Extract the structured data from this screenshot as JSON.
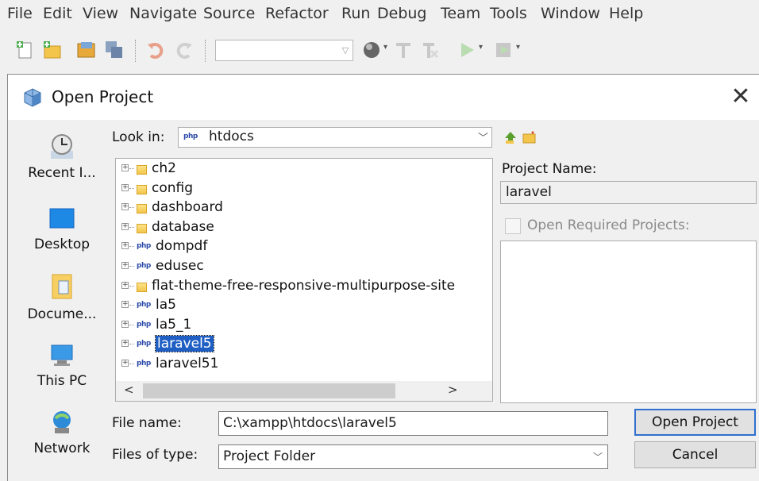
{
  "menubar": {
    "items": [
      "File",
      "Edit",
      "View",
      "Navigate",
      "Source",
      "Refactor",
      "Run",
      "Debug",
      "Team",
      "Tools",
      "Window",
      "Help"
    ]
  },
  "toolbar": {
    "buttons": [
      "new-file-icon",
      "new-project-icon",
      "open-project-icon",
      "save-all-icon",
      "undo-icon",
      "redo-icon",
      "configuration-combo",
      "globe-icon",
      "build-icon",
      "clean-build-icon",
      "run-icon",
      "debug-icon"
    ],
    "configuration_value": ""
  },
  "dialog": {
    "title": "Open Project",
    "close_glyph": "✕",
    "look_in_label": "Look in:",
    "look_in_php_tag": "php",
    "look_in_value": "htdocs",
    "places": [
      {
        "label": "Recent I...",
        "icon": "recent-items-icon"
      },
      {
        "label": "Desktop",
        "icon": "desktop-icon"
      },
      {
        "label": "Docume...",
        "icon": "documents-icon"
      },
      {
        "label": "This PC",
        "icon": "this-pc-icon"
      },
      {
        "label": "Network",
        "icon": "network-icon"
      }
    ],
    "tree_items": [
      {
        "name": "ch2",
        "type": "folder"
      },
      {
        "name": "config",
        "type": "folder"
      },
      {
        "name": "dashboard",
        "type": "folder"
      },
      {
        "name": "database",
        "type": "folder"
      },
      {
        "name": "dompdf",
        "type": "php"
      },
      {
        "name": "edusec",
        "type": "php"
      },
      {
        "name": "flat-theme-free-responsive-multipurpose-site",
        "type": "folder"
      },
      {
        "name": "la5",
        "type": "php"
      },
      {
        "name": "la5_1",
        "type": "php"
      },
      {
        "name": "laravel5",
        "type": "php",
        "selected": true
      },
      {
        "name": "laravel51",
        "type": "php"
      }
    ],
    "project_name_label": "Project Name:",
    "project_name_value": "laravel",
    "open_required_label": "Open Required Projects:",
    "file_name_label": "File name:",
    "file_name_value": "C:\\xampp\\htdocs\\laravel5",
    "files_of_type_label": "Files of type:",
    "files_of_type_value": "Project Folder",
    "open_button": "Open Project",
    "cancel_button": "Cancel"
  },
  "colors": {
    "selection": "#1f5fc4",
    "default_button_border": "#2f6fce",
    "folder": "#f3c54a",
    "php_tag": "#2b4aa8"
  }
}
